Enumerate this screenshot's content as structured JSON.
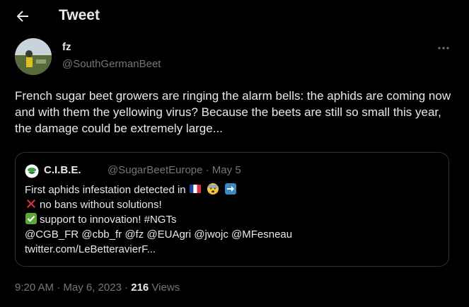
{
  "header": {
    "title": "Tweet"
  },
  "author": {
    "name": "fz",
    "handle": "@SouthGermanBeet"
  },
  "tweet": {
    "text": "French sugar beet growers are ringing the alarm bells: the aphids are coming now and with them the yellowing virus?  Because the beets are still so small this year, the damage could be extremely large..."
  },
  "quote": {
    "name": "C.I.B.E.",
    "meta": "@SugarBeetEurope · May 5",
    "lines": {
      "l1": "First aphids infestation detected in",
      "l2": "no bans without solutions!",
      "l3": "support to innovation! #NGTs",
      "l4": "@CGB_FR @cbb_fr @fz @EUAgri @jwojc @MFesneau",
      "l5": "twitter.com/LeBetteravierF..."
    }
  },
  "footer": {
    "time": "9:20 AM · May 6, 2023 · ",
    "views_count": "216",
    "views_label": " Views"
  },
  "icons": {
    "back": "arrow-left-icon",
    "more": "more-dots-icon",
    "flag": "france-flag-icon",
    "worried": "anxious-face-icon",
    "arrow": "right-arrow-icon",
    "cross": "red-cross-icon",
    "check": "green-check-icon"
  },
  "colors": {
    "background": "#000000",
    "text": "#e7e9ea",
    "muted": "#71767b",
    "border": "#2f3336"
  }
}
